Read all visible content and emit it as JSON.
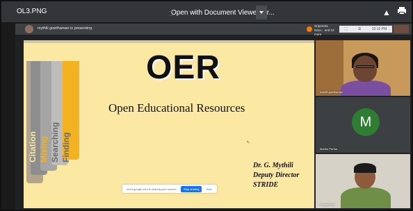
{
  "viewer": {
    "file_name": "OL3.PNG",
    "open_with_label": "Open with Document Viewer for...",
    "icons": [
      "doc-icon",
      "chevron-down-icon",
      "drive-add-icon",
      "print-icon"
    ]
  },
  "meet": {
    "presenting_text": "mythili gowthaman is presenting",
    "people_text": "Nripendra Nara... and 10 more",
    "top_controls": [
      "⛶",
      "☰",
      "12:12 PM"
    ],
    "slide": {
      "title": "OER",
      "subtitle": "Open Educational Resources",
      "tabs": [
        "Citation",
        "Mixing",
        "Searching",
        "Finding"
      ],
      "signature": [
        "Dr. G. Mythili",
        "Deputy Director",
        "STRIDE"
      ],
      "share_bar": {
        "text": "meet.google.com is sharing your screen.",
        "stop_label": "Stop sharing",
        "hide_label": "Hide"
      }
    },
    "participants": [
      {
        "name": "mythili gowthaman"
      },
      {
        "name": "Madhu Parhar",
        "initial": "M"
      },
      {
        "name": "Prasad Rao"
      }
    ]
  },
  "colors": {
    "slide_bg": "#fbe9a3",
    "accent_orange": "#f3b21f",
    "avatar_green": "#2e7d32",
    "meet_bg": "#202124"
  }
}
